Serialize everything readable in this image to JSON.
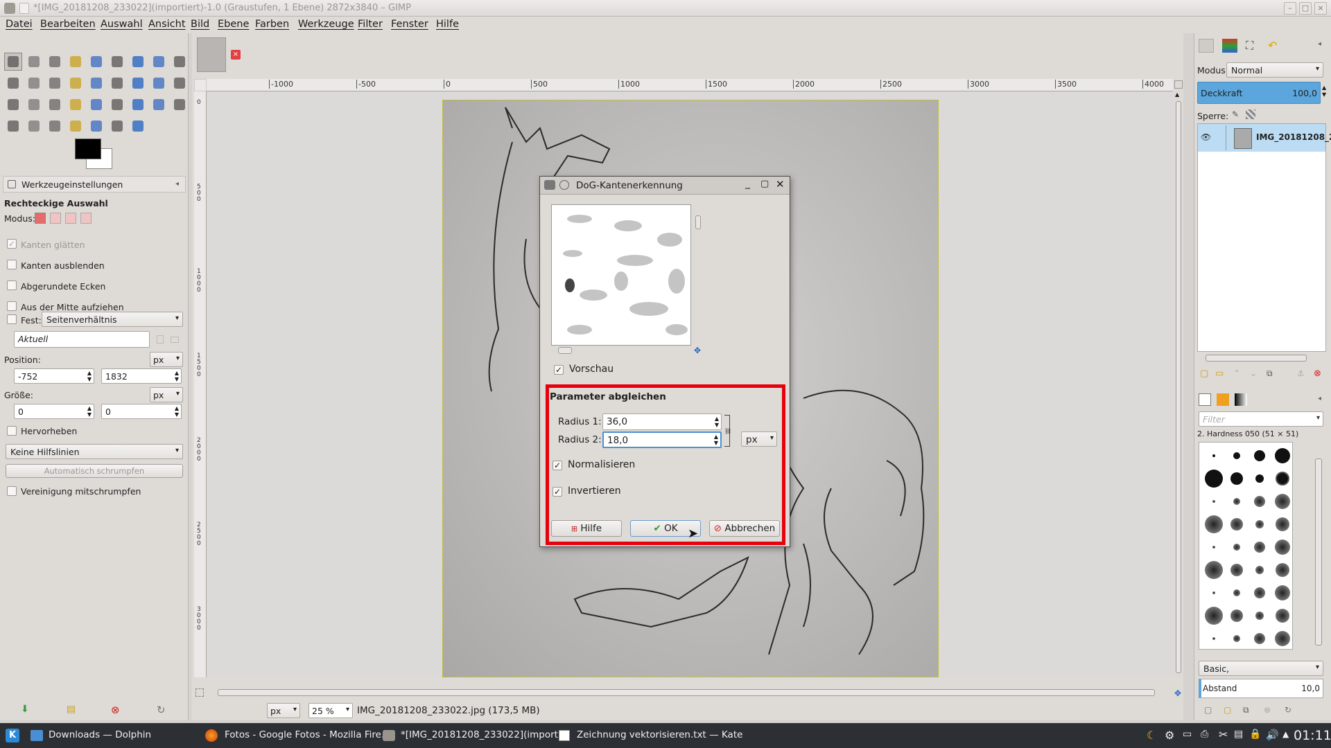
{
  "window": {
    "title": "*[IMG_20181208_233022](importiert)-1.0 (Graustufen, 1 Ebene) 2872x3840 – GIMP"
  },
  "menu": [
    "Datei",
    "Bearbeiten",
    "Auswahl",
    "Ansicht",
    "Bild",
    "Ebene",
    "Farben",
    "Werkzeuge",
    "Filter",
    "Fenster",
    "Hilfe"
  ],
  "tool_options": {
    "tab_label": "Werkzeugeinstellungen",
    "tool_name": "Rechteckige Auswahl",
    "mode_label": "Modus:",
    "checkboxes": [
      "Kanten glätten",
      "Kanten ausblenden",
      "Abgerundete Ecken",
      "Aus der Mitte aufziehen"
    ],
    "fixed_label": "Fest:",
    "fixed_value": "Seitenverhältnis",
    "aktuell": "Aktuell",
    "position_label": "Position:",
    "position_x": "-752",
    "position_y": "1832",
    "unit": "px",
    "size_label": "Größe:",
    "size_w": "0",
    "size_h": "0",
    "highlight": "Hervorheben",
    "guides": "Keine Hilfslinien",
    "auto_shrink": "Automatisch schrumpfen",
    "shrink_merged": "Vereinigung mitschrumpfen"
  },
  "ruler": {
    "labels": [
      "-1000",
      "-500",
      "0",
      "500",
      "1000",
      "1500",
      "2000",
      "2500",
      "3000",
      "3500",
      "4000"
    ]
  },
  "ruler_v": [
    "0",
    "5\n0\n0",
    "1\n0\n0\n0",
    "1\n5\n0\n0",
    "2\n0\n0\n0",
    "2\n5\n0\n0",
    "3\n0\n0\n0"
  ],
  "status": {
    "unit": "px",
    "zoom": "25 %",
    "file": "IMG_20181208_233022.jpg (173,5 MB)"
  },
  "dialog": {
    "title": "DoG-Kantenerkennung",
    "preview_label": "Vorschau",
    "section": "Parameter abgleichen",
    "radius1_label": "Radius 1:",
    "radius1": "36,0",
    "radius2_label": "Radius 2:",
    "radius2": "18,0",
    "unit": "px",
    "normalize": "Normalisieren",
    "invert": "Invertieren",
    "help": "Hilfe",
    "ok": "OK",
    "cancel": "Abbrechen"
  },
  "layers": {
    "mode_label": "Modus:",
    "mode_value": "Normal",
    "opacity_label": "Deckkraft",
    "opacity_value": "100,0",
    "lock_label": "Sperre:",
    "layer_name": "IMG_20181208_2"
  },
  "brushes": {
    "filter_placeholder": "Filter",
    "brush_name": "2. Hardness 050 (51 × 51)",
    "preset": "Basic,",
    "spacing_label": "Abstand",
    "spacing_value": "10,0"
  },
  "taskbar": {
    "items": [
      "Downloads — Dolphin",
      "Fotos - Google Fotos - Mozilla Fire...",
      "*[IMG_20181208_233022](importi...",
      "Zeichnung vektorisieren.txt — Kate"
    ],
    "clock": "01:11"
  }
}
